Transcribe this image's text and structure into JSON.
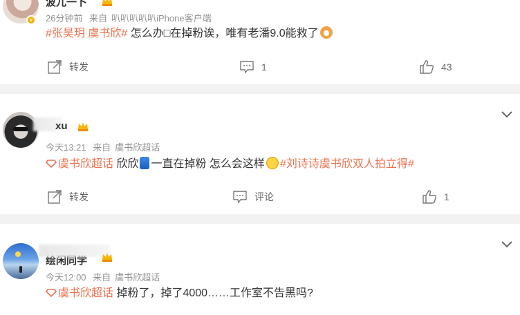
{
  "posts": [
    {
      "username": "波兀一卜",
      "time": "26分钟前",
      "source_prefix": "来自",
      "source": "叭叭叭叭叭iPhone客户端",
      "content": {
        "tag": "#张昊玥 虞书欣#",
        "text": " 怎么办□在掉粉诶，唯有老潘9.0能救了"
      },
      "actions": {
        "repost": "转发",
        "comments": "1",
        "likes": "43"
      }
    },
    {
      "username": "xu",
      "time": "今天13:21",
      "source_prefix": "来自",
      "source": "虞书欣超话",
      "content": {
        "super_tag": "虞书欣超话",
        "text_a": " 欣欣",
        "text_b": "一直在掉粉 怎么会这样",
        "tag": "#刘诗诗虞书欣双人拍立得#"
      },
      "actions": {
        "repost": "转发",
        "comments": "评论",
        "likes": "1"
      }
    },
    {
      "username": "绘闲同学",
      "time": "今天12:00",
      "source_prefix": "来自",
      "source": "虞书欣超话",
      "content": {
        "super_tag": "虞书欣超话",
        "text": " 掉粉了，掉了4000……工作室不告黑吗?"
      }
    }
  ],
  "colors": {
    "accent": "#eb7350",
    "meta": "#939393",
    "text": "#333333",
    "background": "#f2f2f2"
  },
  "icons": [
    "repost-icon",
    "comment-icon",
    "like-icon",
    "chevron-down-icon",
    "crown-icon",
    "verified-badge-icon"
  ]
}
